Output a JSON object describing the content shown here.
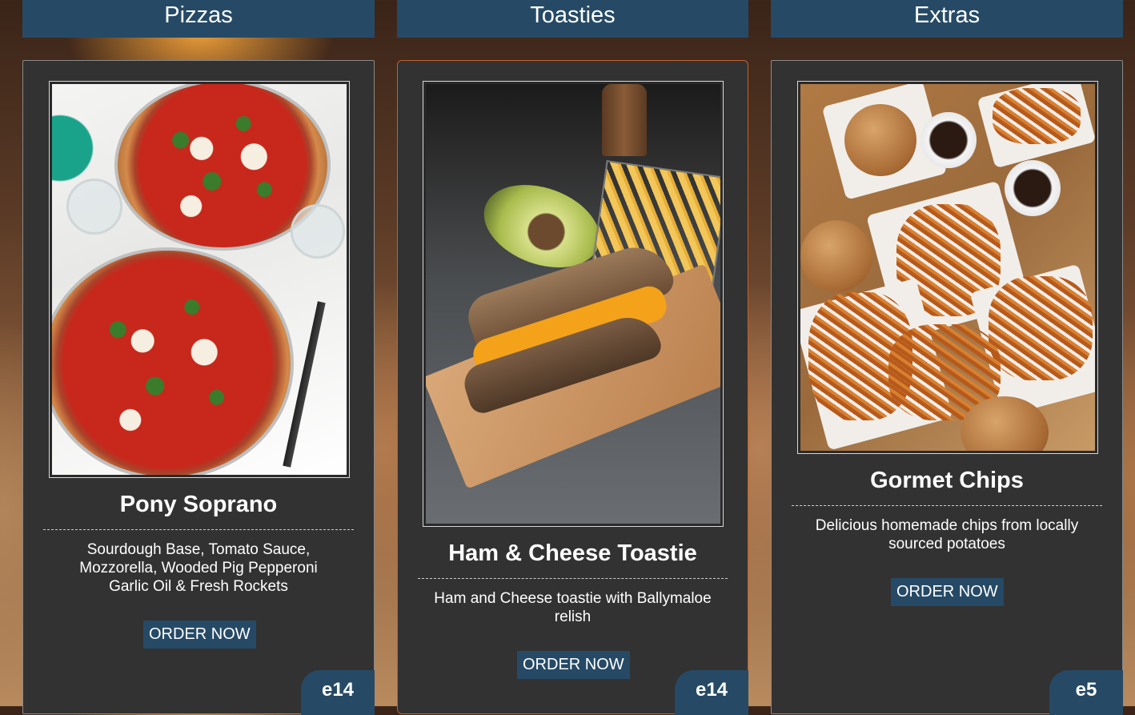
{
  "categories": [
    {
      "header": "Pizzas",
      "item": {
        "title": "Pony Soprano",
        "description_lines": [
          "Sourdough Base, Tomato Sauce,",
          "Mozzorella, Wooded Pig Pepperoni",
          "Garlic Oil & Fresh Rockets"
        ],
        "button_label": "ORDER NOW",
        "price": "e14"
      }
    },
    {
      "header": "Toasties",
      "item": {
        "title": "Ham & Cheese Toastie",
        "description_lines": [
          "Ham and Cheese toastie with Ballymaloe",
          "relish"
        ],
        "button_label": "ORDER NOW",
        "price": "e14"
      }
    },
    {
      "header": "Extras",
      "item": {
        "title": "Gormet Chips",
        "description_lines": [
          "Delicious homemade chips from locally",
          "sourced potatoes"
        ],
        "button_label": "ORDER NOW",
        "price": "e5"
      }
    }
  ],
  "colors": {
    "header_bg": "#264a66",
    "card_bg": "#323232",
    "active_card_border": "#c0622c"
  }
}
